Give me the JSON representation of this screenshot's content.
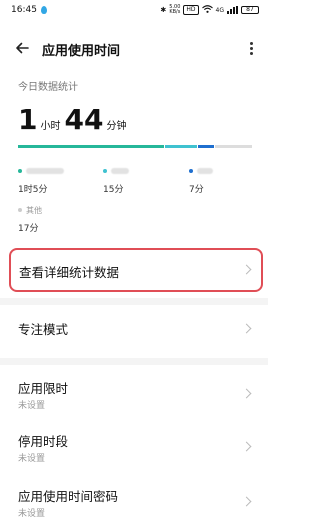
{
  "status_bar": {
    "time": "16:45",
    "speed": "5.00\nKB/s",
    "badge_hd": "HD",
    "network": "4G",
    "battery": "87"
  },
  "header": {
    "title": "应用使用时间"
  },
  "stats": {
    "section_label": "今日数据统计",
    "hours_value": "1",
    "hours_unit": "小时",
    "minutes_value": "44",
    "minutes_unit": "分钟",
    "bar_segments": [
      {
        "color": "#26b79a",
        "fraction": 0.63
      },
      {
        "color": "#3fc2d0",
        "fraction": 0.14
      },
      {
        "color": "#1f6fcf",
        "fraction": 0.07
      },
      {
        "color": "#dddddd",
        "fraction": 0.16
      }
    ],
    "legend": [
      {
        "dot_color": "#26b79a",
        "value": "1时5分"
      },
      {
        "dot_color": "#3fc2d0",
        "value": "15分"
      },
      {
        "dot_color": "#1f6fcf",
        "value": "7分"
      },
      {
        "dot_color": "#cccccc",
        "name": "其他",
        "value": "17分"
      }
    ]
  },
  "menu": {
    "details": {
      "title": "查看详细统计数据"
    },
    "focus": {
      "title": "专注模式"
    },
    "app_limit": {
      "title": "应用限时",
      "subtitle": "未设置"
    },
    "downtime": {
      "title": "停用时段",
      "subtitle": "未设置"
    },
    "password": {
      "title": "应用使用时间密码",
      "subtitle": "未设置"
    }
  }
}
